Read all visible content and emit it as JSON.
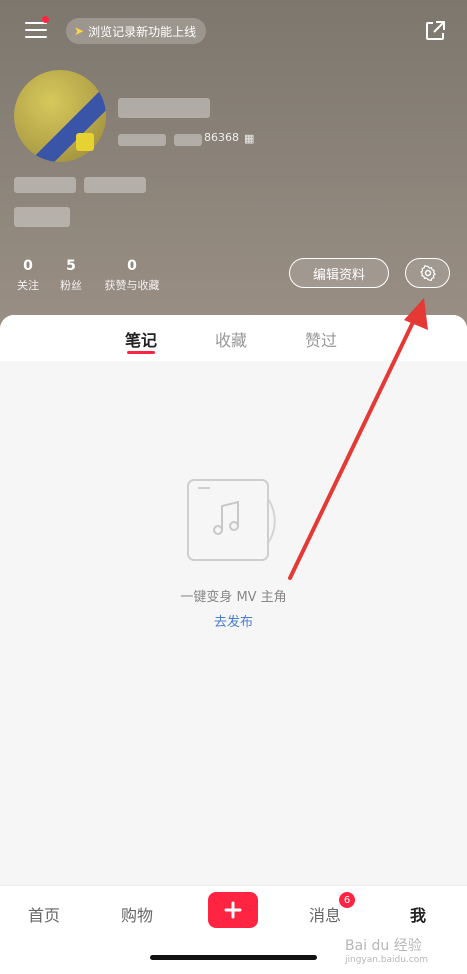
{
  "header": {
    "history_pill": "浏览记录新功能上线",
    "stats": [
      {
        "num": "0",
        "label": "关注"
      },
      {
        "num": "5",
        "label": "粉丝"
      },
      {
        "num": "0",
        "label": "获赞与收藏"
      }
    ],
    "edit_profile": "编辑资料",
    "account_id_partial": "86368"
  },
  "tabs": [
    {
      "label": "笔记",
      "active": true
    },
    {
      "label": "收藏",
      "active": false
    },
    {
      "label": "赞过",
      "active": false
    }
  ],
  "empty_state": {
    "text": "一键变身 MV 主角",
    "link": "去发布"
  },
  "bottom_nav": {
    "items": [
      "首页",
      "购物",
      "消息",
      "我"
    ],
    "message_badge": "6"
  },
  "watermark": {
    "brand": "Bai du 经验",
    "url": "jingyan.baidu.com"
  },
  "colors": {
    "accent": "#ff2442",
    "link": "#4a7ec9"
  }
}
